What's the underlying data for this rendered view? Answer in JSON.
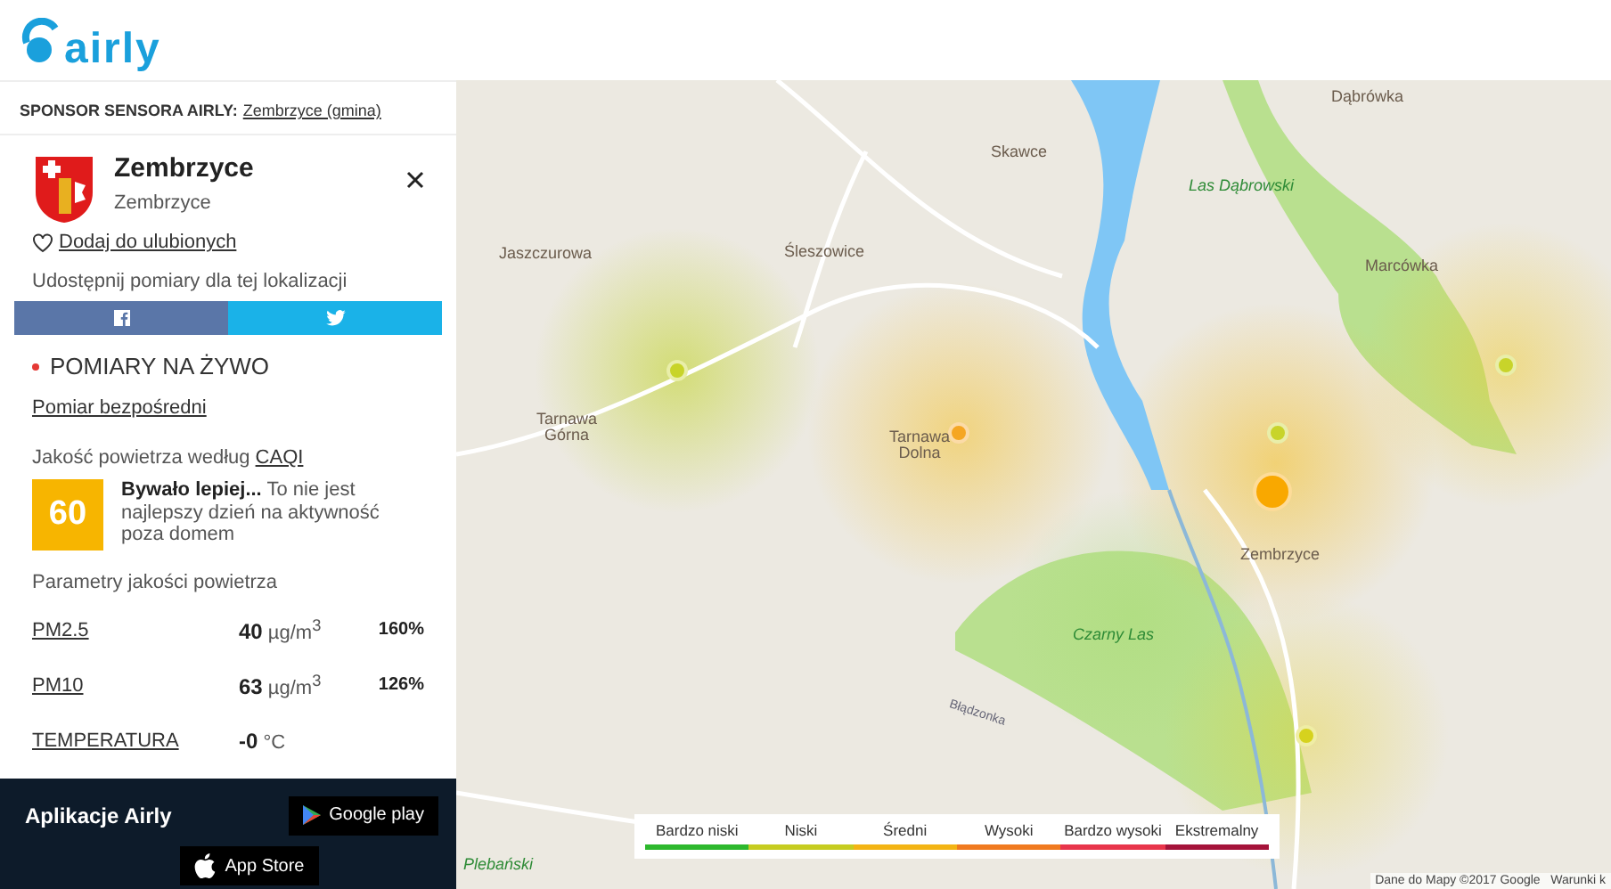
{
  "logo": "airly",
  "sponsor": {
    "label": "SPONSOR SENSORA AIRLY:",
    "link": "Zembrzyce (gmina)"
  },
  "location": {
    "title": "Zembrzyce",
    "subtitle": "Zembrzyce",
    "favorite": "Dodaj do ulubionych",
    "share": "Udostępnij pomiary dla tej lokalizacji"
  },
  "live": {
    "heading": "POMIARY NA ŻYWO",
    "mode": "Pomiar bezpośredni",
    "caqi_label": "Jakość powietrza według",
    "caqi_link": "CAQI",
    "index": "60",
    "description": "**Bywało lepiej...** To nie jest najlepszy dzień na aktywność poza domem",
    "params_title": "Parametry jakości powietrza"
  },
  "parameters": [
    {
      "name": "PM2.5",
      "value": "40",
      "unit": "µg/m$^{3}$",
      "percent": "160%"
    },
    {
      "name": "PM10",
      "value": "63",
      "unit": "µg/m$^{3}$",
      "percent": "126%"
    },
    {
      "name": "TEMPERATURA",
      "value": "-0",
      "unit": "°C"
    }
  ],
  "apps": {
    "title": "Aplikacje Airly",
    "buttons": [
      {
        "kind": "google",
        "label": "Google play"
      },
      {
        "kind": "apple",
        "label": "App Store"
      }
    ]
  },
  "map": {
    "places": [
      {
        "kind": "town",
        "label": "Dąbrówka"
      },
      {
        "kind": "town",
        "label": "Skawce"
      },
      {
        "kind": "forest",
        "label": "Las Dąbrowski"
      },
      {
        "kind": "town",
        "label": "Jaszczurowa"
      },
      {
        "kind": "town",
        "label": "Śleszowice"
      },
      {
        "kind": "town",
        "label": "Marcówka"
      },
      {
        "kind": "town",
        "label": "Tarnawa Górna"
      },
      {
        "kind": "town",
        "label": "Tarnawa Dolna"
      },
      {
        "kind": "town",
        "label": "Zembrzyce"
      },
      {
        "kind": "forest",
        "label": "Czarny Las"
      },
      {
        "kind": "stream",
        "label": "Błądzonka"
      },
      {
        "kind": "forest",
        "label": "Plebański"
      }
    ],
    "sensors": [
      {
        "color": "#c8d42a"
      },
      {
        "color": "#f5a623"
      },
      {
        "color": "#c8d42a"
      },
      {
        "color": "#f9a800"
      },
      {
        "color": "#c8d42a"
      },
      {
        "color": "#d6d21e"
      }
    ],
    "legend": [
      {
        "label": "Bardzo niski",
        "color": "#2db82d"
      },
      {
        "label": "Niski",
        "color": "#c6cc20"
      },
      {
        "label": "Średni",
        "color": "#f3b414"
      },
      {
        "label": "Wysoki",
        "color": "#f07a1f"
      },
      {
        "label": "Bardzo wysoki",
        "color": "#e8354b"
      },
      {
        "label": "Ekstremalny",
        "color": "#a5133a"
      }
    ],
    "attribution": "Dane do Mapy ©2017 Google   Warunki k"
  }
}
